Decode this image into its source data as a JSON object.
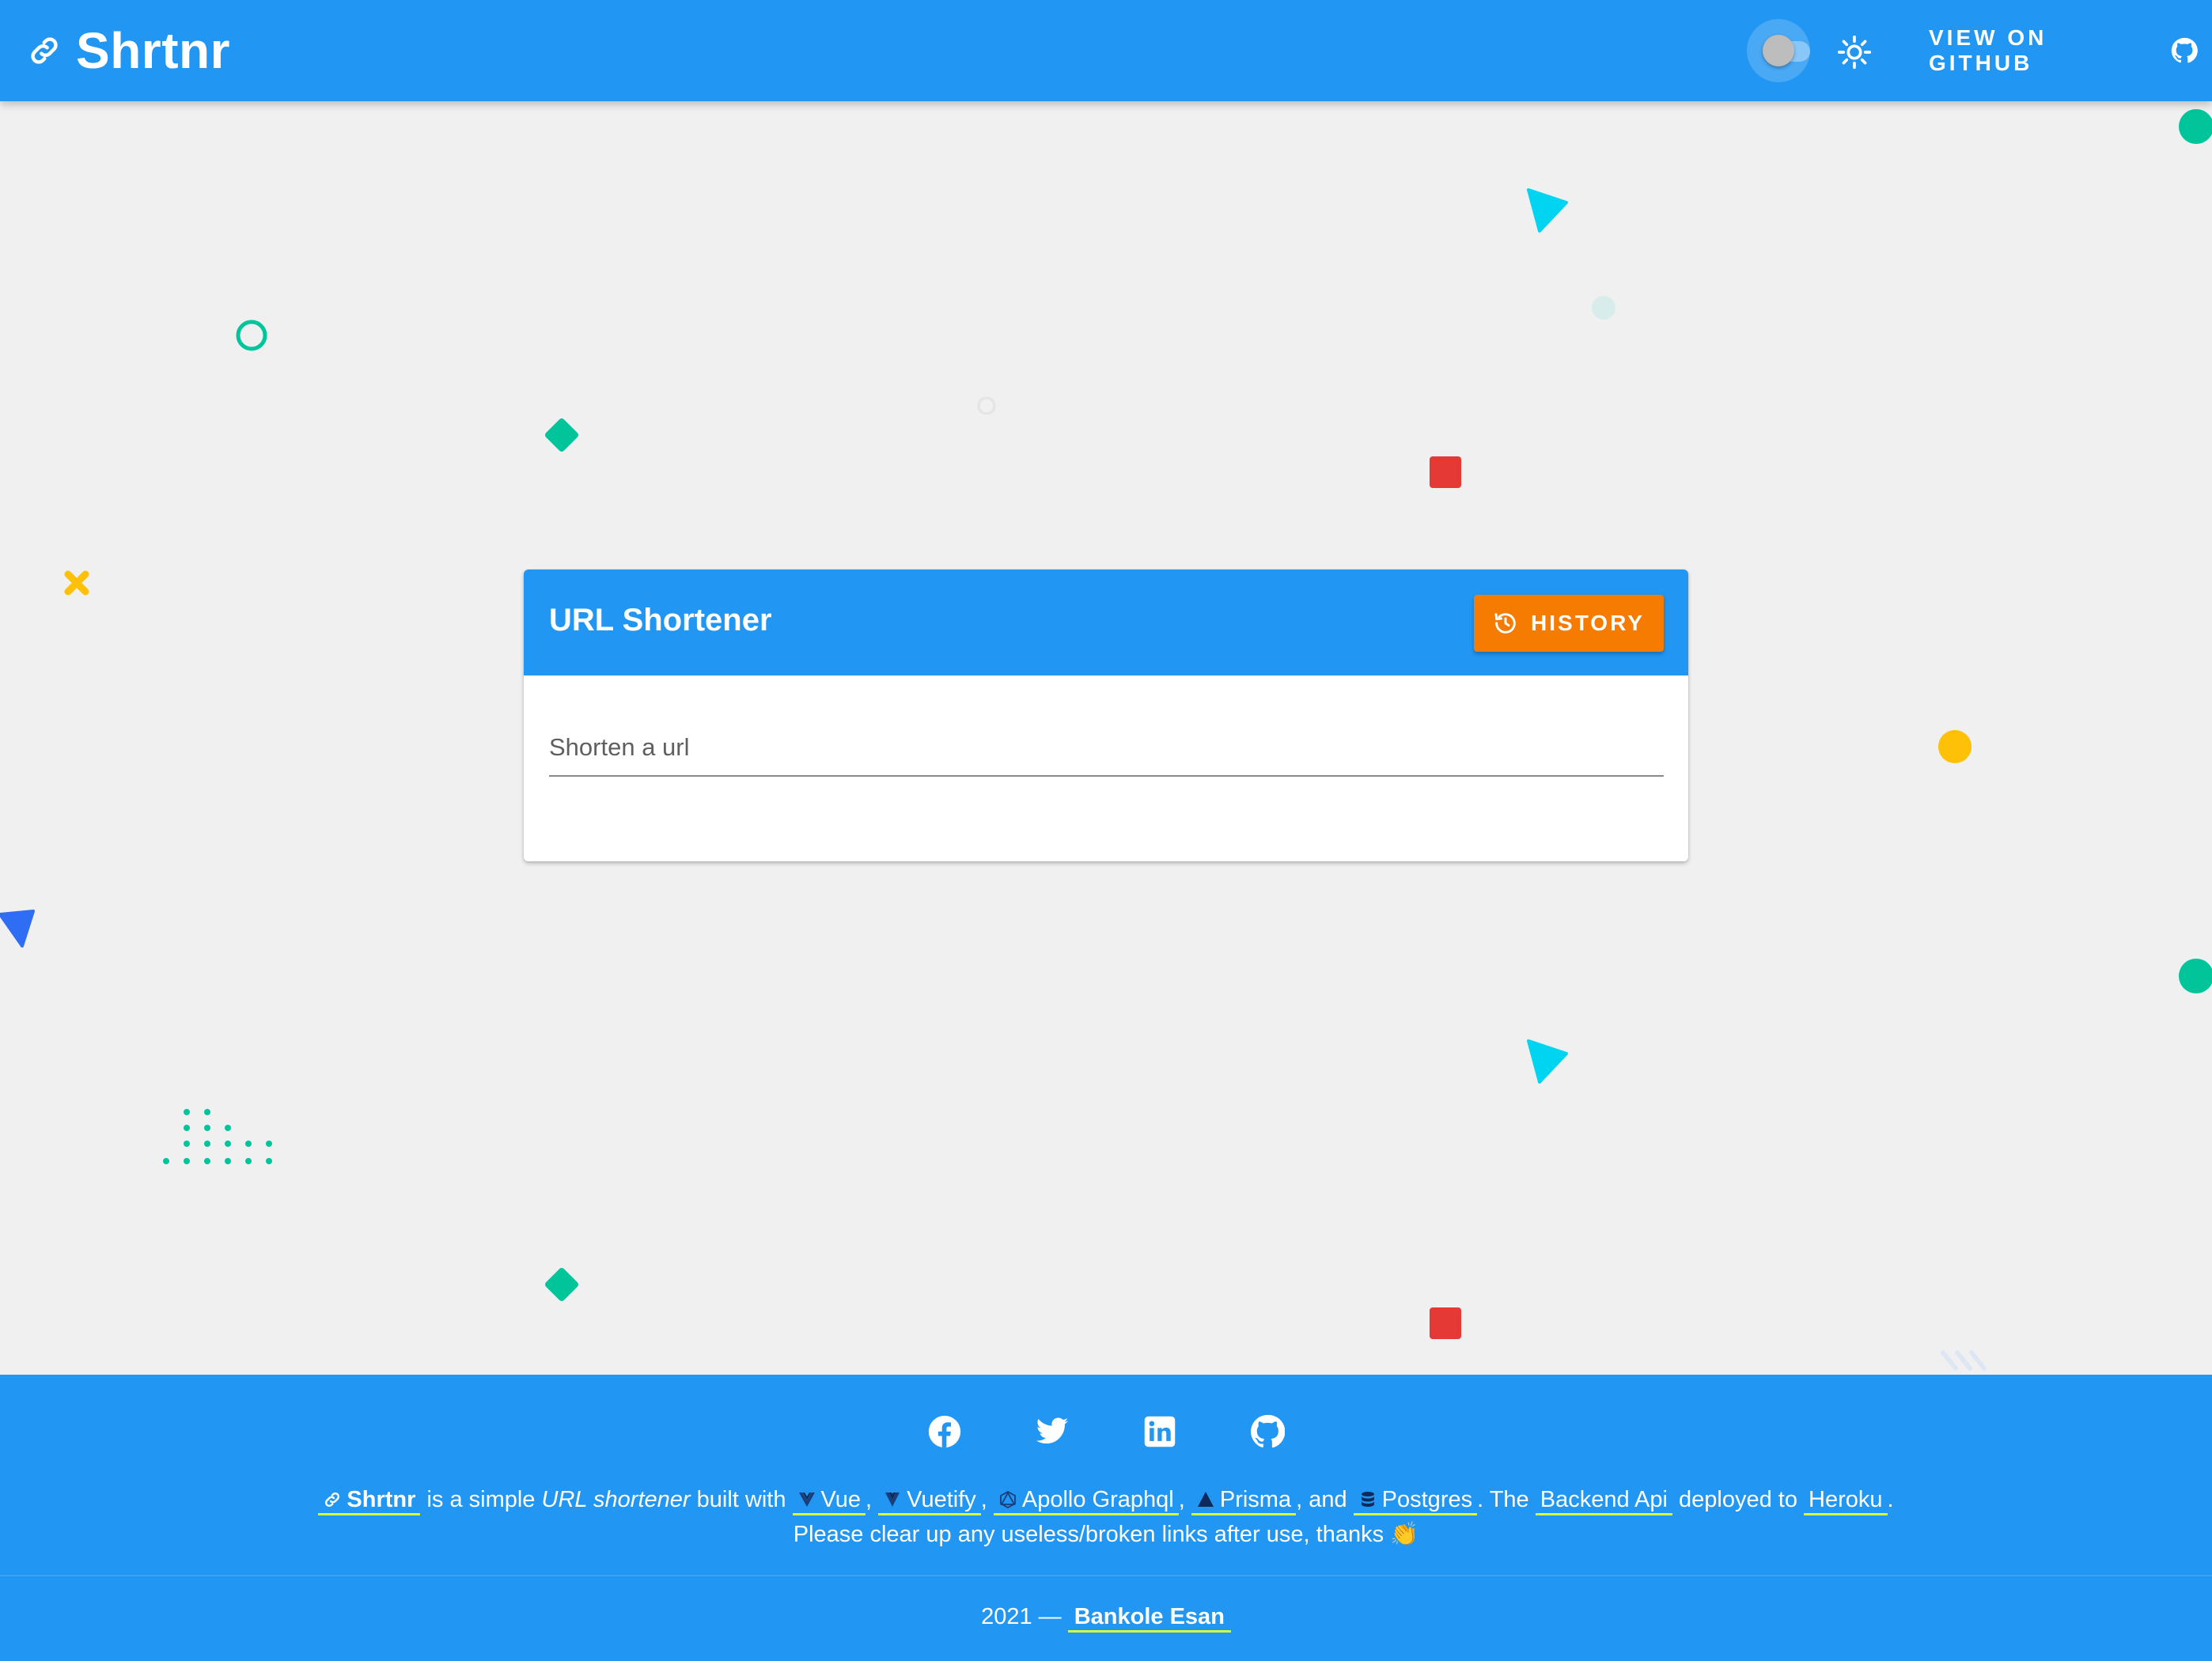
{
  "app": {
    "title": "Shrtnr",
    "github_label": "VIEW ON GITHUB"
  },
  "theme_toggle": {
    "state": "off",
    "icon": "brightness-icon"
  },
  "card": {
    "title": "URL Shortener",
    "history_label": "HISTORY",
    "input_placeholder": "Shorten a url",
    "input_value": ""
  },
  "footer": {
    "social": [
      "facebook-icon",
      "twitter-icon",
      "linkedin-icon",
      "github-icon"
    ],
    "about": {
      "brand": "Shrtnr",
      "t1": " is a simple ",
      "emph": "URL shortener",
      "t2": " built with ",
      "vue": "Vue",
      "vuetify": "Vuetify",
      "apollo": "Apollo Graphql",
      "prisma": "Prisma",
      "t3": ", and ",
      "postgres": "Postgres",
      "t4": ". The ",
      "backend": "Backend Api",
      "t5": " deployed to ",
      "heroku": "Heroku",
      "t6": ".",
      "line2": "Please clear up any useless/broken links after use, thanks 👏"
    },
    "year": "2021 —",
    "author": "Bankole Esan"
  },
  "colors": {
    "primary": "#2196f3",
    "accent": "#f57c00",
    "background": "#f0f0f0",
    "link_underline": "#d4ff3a"
  }
}
